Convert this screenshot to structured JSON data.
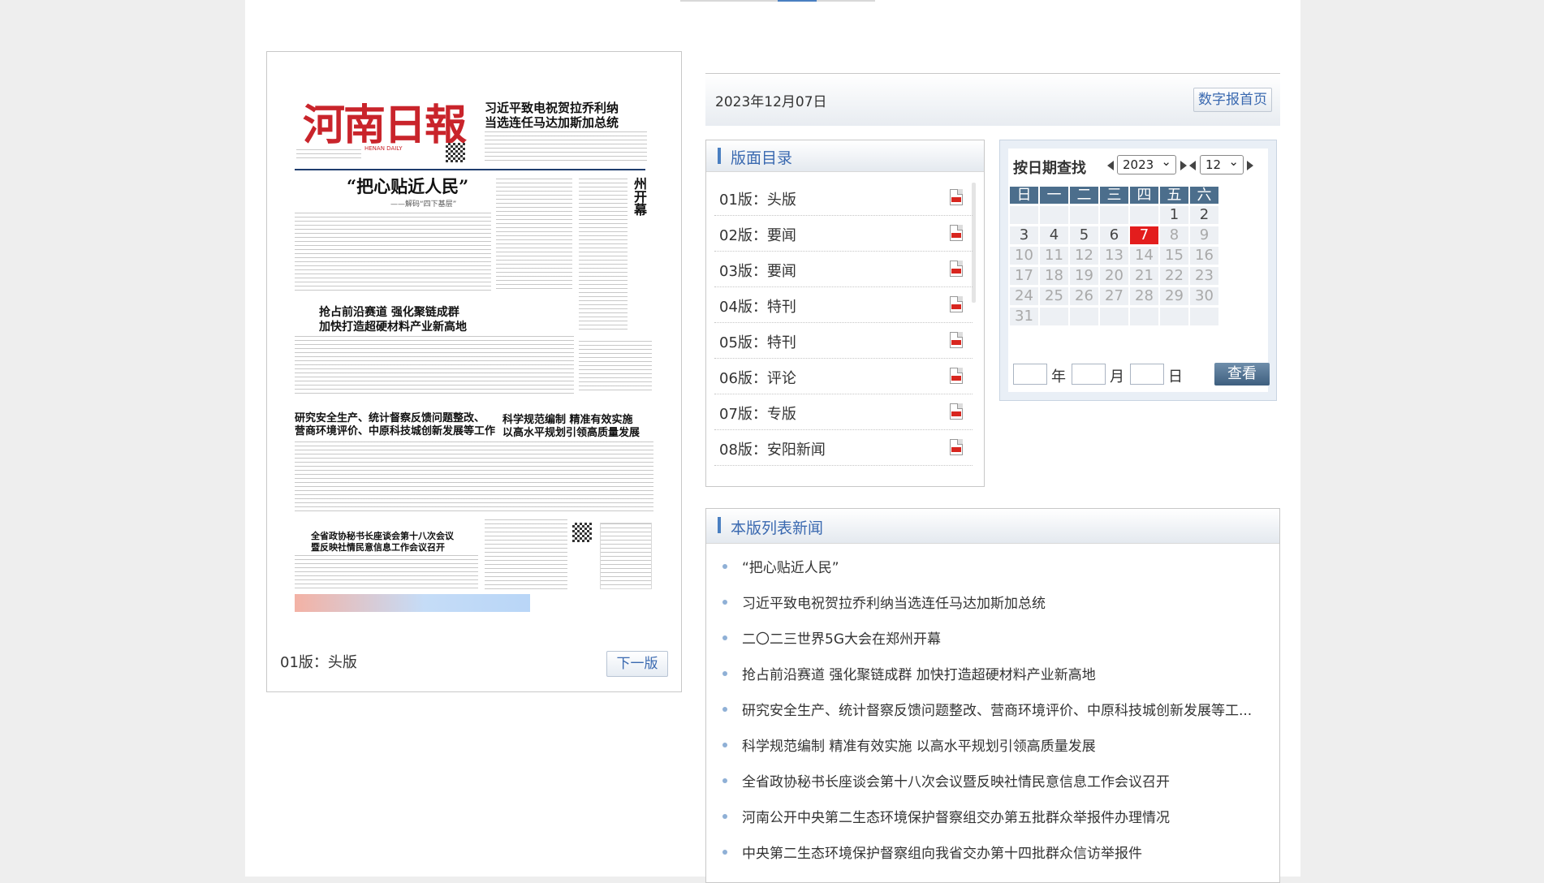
{
  "paper": {
    "current_label": "01版：头版",
    "next_label": "下一版",
    "masthead": "河南日報",
    "masthead_en": "HENAN DAILY",
    "headlines": {
      "top_right_1": "习近平致电祝贺拉乔利纳",
      "top_right_2": "当选连任马达加斯加总统",
      "lead": "“把心贴近人民”",
      "lead_sub": "——解码“四下基层”",
      "vertical": "二〇二三世界5G大会在郑州开幕",
      "second_1": "抢占前沿赛道 强化聚链成群",
      "second_2": "加快打造超硬材料产业新高地",
      "third_1": "研究安全生产、统计督察反馈问题整改、",
      "third_2": "营商环境评价、中原科技城创新发展等工作",
      "fourth_1": "科学规范编制 精准有效实施",
      "fourth_2": "以高水平规划引领高质量发展",
      "fifth_1": "全省政协秘书长座谈会第十八次会议",
      "fifth_2": "暨反映社情民意信息工作会议召开"
    }
  },
  "header": {
    "date": "2023年12月07日",
    "home_button": "数字报首页"
  },
  "sections": {
    "title": "版面目录",
    "items": [
      {
        "label": "01版：头版"
      },
      {
        "label": "02版：要闻"
      },
      {
        "label": "03版：要闻"
      },
      {
        "label": "04版：特刊"
      },
      {
        "label": "05版：特刊"
      },
      {
        "label": "06版：评论"
      },
      {
        "label": "07版：专版"
      },
      {
        "label": "08版：安阳新闻"
      }
    ]
  },
  "calendar": {
    "title": "按日期查找",
    "year": "2023",
    "month": "12",
    "weekdays": [
      "日",
      "一",
      "二",
      "三",
      "四",
      "五",
      "六"
    ],
    "selected_day": 7,
    "year_unit": "年",
    "month_unit": "月",
    "day_unit": "日",
    "submit": "查看"
  },
  "articles": {
    "title": "本版列表新闻",
    "items": [
      "“把心贴近人民”",
      "习近平致电祝贺拉乔利纳当选连任马达加斯加总统",
      "二〇二三世界5G大会在郑州开幕",
      "抢占前沿赛道 强化聚链成群 加快打造超硬材料产业新高地",
      "研究安全生产、统计督察反馈问题整改、营商环境评价、中原科技城创新发展等工...",
      "科学规范编制 精准有效实施 以高水平规划引领高质量发展",
      "全省政协秘书长座谈会第十八次会议暨反映社情民意信息工作会议召开",
      "河南公开中央第二生态环境保护督察组交办第五批群众举报件办理情况",
      "中央第二生态环境保护督察组向我省交办第十四批群众信访举报件"
    ]
  },
  "colors": {
    "accent": "#3a69b0",
    "today": "#e31d1d",
    "calendar_header": "#4c6e8c",
    "masthead": "#c9242b"
  }
}
